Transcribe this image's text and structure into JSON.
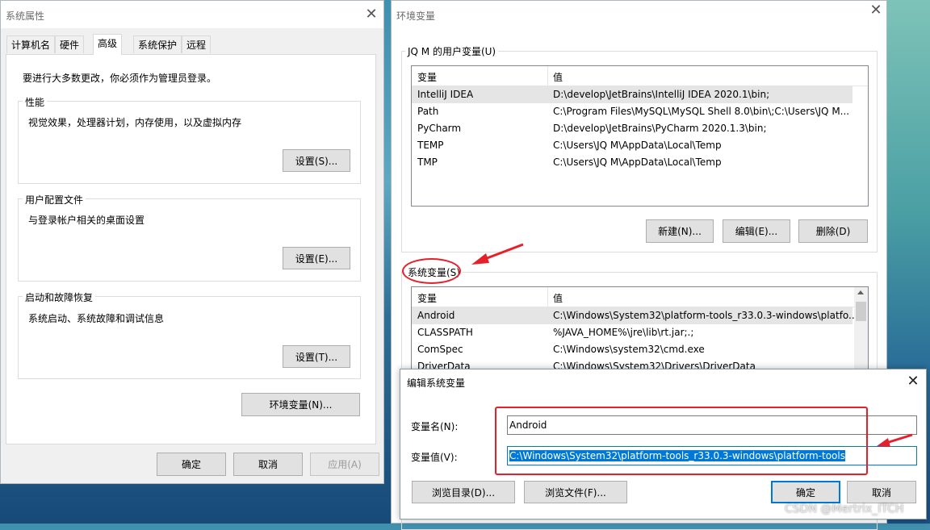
{
  "system_properties": {
    "title": "系统属性",
    "tabs": [
      "计算机名",
      "硬件",
      "高级",
      "系统保护",
      "远程"
    ],
    "notice": "要进行大多数更改，你必须作为管理员登录。",
    "performance": {
      "label": "性能",
      "desc": "视觉效果，处理器计划，内存使用，以及虚拟内存",
      "button": "设置(S)..."
    },
    "user_profiles": {
      "label": "用户配置文件",
      "desc": "与登录帐户相关的桌面设置",
      "button": "设置(E)..."
    },
    "startup": {
      "label": "启动和故障恢复",
      "desc": "系统启动、系统故障和调试信息",
      "button": "设置(T)..."
    },
    "env_button": "环境变量(N)...",
    "ok": "确定",
    "cancel": "取消",
    "apply": "应用(A)"
  },
  "env_vars": {
    "title": "环境变量",
    "user_group_label": "JQ M 的用户变量(U)",
    "columns": [
      "变量",
      "值"
    ],
    "user_vars": [
      {
        "name": "IntelliJ IDEA",
        "value": "D:\\develop\\JetBrains\\IntelliJ IDEA 2020.1\\bin;"
      },
      {
        "name": "Path",
        "value": "C:\\Program Files\\MySQL\\MySQL Shell 8.0\\bin\\;C:\\Users\\JQ M..."
      },
      {
        "name": "PyCharm",
        "value": "D:\\develop\\JetBrains\\PyCharm 2020.1.3\\bin;"
      },
      {
        "name": "TEMP",
        "value": "C:\\Users\\JQ M\\AppData\\Local\\Temp"
      },
      {
        "name": "TMP",
        "value": "C:\\Users\\JQ M\\AppData\\Local\\Temp"
      }
    ],
    "user_buttons": {
      "new": "新建(N)...",
      "edit": "编辑(E)...",
      "delete": "删除(D)"
    },
    "system_group_label": "系统变量(S)",
    "system_vars": [
      {
        "name": "Android",
        "value": "C:\\Windows\\System32\\platform-tools_r33.0.3-windows\\platfo..."
      },
      {
        "name": "CLASSPATH",
        "value": "%JAVA_HOME%\\jre\\lib\\rt.jar;.;"
      },
      {
        "name": "ComSpec",
        "value": "C:\\Windows\\system32\\cmd.exe"
      },
      {
        "name": "DriverData",
        "value": "C:\\Windows\\System32\\Drivers\\DriverData"
      }
    ]
  },
  "edit_dialog": {
    "title": "编辑系统变量",
    "name_label": "变量名(N):",
    "value_label": "变量值(V):",
    "name_value": "Android",
    "value_value": "C:\\Windows\\System32\\platform-tools_r33.0.3-windows\\platform-tools",
    "browse_dir": "浏览目录(D)...",
    "browse_file": "浏览文件(F)...",
    "ok": "确定",
    "cancel": "取消"
  },
  "watermark": "CSDN @Mertrix_ITCH",
  "colors": {
    "annotation_red": "#e5202b",
    "selection_blue": "#0078d7"
  }
}
